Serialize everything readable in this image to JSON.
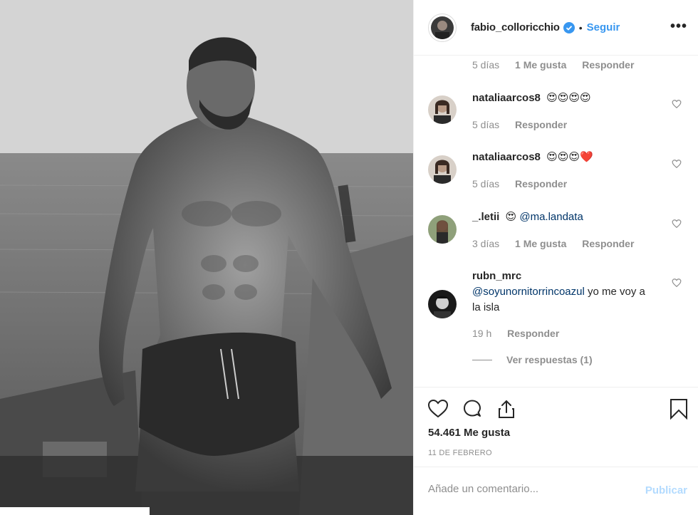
{
  "post": {
    "author": "fabio_colloricchio",
    "follow_label": "Seguir",
    "separator": "•",
    "more_label": "•••"
  },
  "comments": [
    {
      "user": "",
      "text": "",
      "time": "5 días",
      "likes": "1 Me gusta",
      "reply": "Responder"
    },
    {
      "user": "nataliaarcos8",
      "text": "😍😍😍😍",
      "time": "5 días",
      "reply": "Responder"
    },
    {
      "user": "nataliaarcos8",
      "text": "😍😍😍❤️",
      "time": "5 días",
      "reply": "Responder"
    },
    {
      "user": "_.letii",
      "text": "😍",
      "mention": "@ma.landata",
      "time": "3 días",
      "likes": "1 Me gusta",
      "reply": "Responder"
    },
    {
      "user": "rubn_mrc",
      "mention": "@soyunornitorrincoazul",
      "text": " yo me voy a la isla",
      "time": "19 h",
      "reply": "Responder"
    }
  ],
  "view_replies": "Ver respuestas (1)",
  "likes_count": "54.461 Me gusta",
  "date": "11 DE FEBRERO",
  "composer": {
    "placeholder": "Añade un comentario...",
    "publish_label": "Publicar"
  },
  "colors": {
    "link": "#3897f0",
    "mention": "#003569",
    "muted": "#8e8e8e",
    "publish_disabled": "#b3dbff"
  },
  "icons": {
    "like": "heart-icon",
    "comment": "comment-icon",
    "share": "share-icon",
    "save": "bookmark-icon",
    "verified": "verified-badge-icon",
    "options": "more-options-icon"
  }
}
